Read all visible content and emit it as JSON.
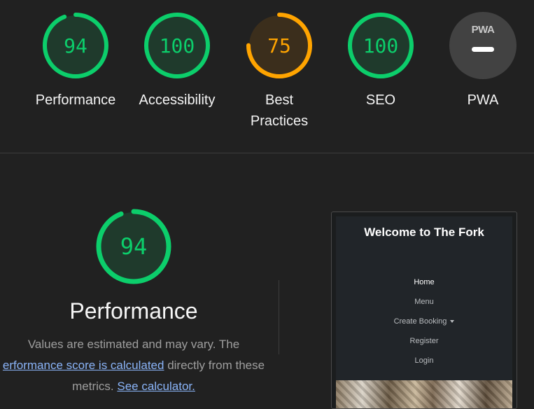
{
  "categories": [
    {
      "score": 94,
      "label_line1": "Performance",
      "label_line2": "",
      "color": "#0cce6b"
    },
    {
      "score": 100,
      "label_line1": "Accessibility",
      "label_line2": "",
      "color": "#0cce6b"
    },
    {
      "score": 75,
      "label_line1": "Best",
      "label_line2": "Practices",
      "color": "#ffa400"
    },
    {
      "score": 100,
      "label_line1": "SEO",
      "label_line2": "",
      "color": "#0cce6b"
    }
  ],
  "pwa": {
    "label": "PWA",
    "badge_text": "PWA"
  },
  "performance": {
    "score": 94,
    "color": "#0cce6b",
    "title": "Performance",
    "desc_line1": "Values are estimated and may vary. The",
    "desc_link1": "erformance score is calculated",
    "desc_after_link1": " directly from these",
    "desc_line3_prefix": "metrics. ",
    "desc_link2": "See calculator."
  },
  "screenshot": {
    "title": "Welcome to The Fork",
    "nav": [
      "Home",
      "Menu",
      "Create Booking",
      "Register",
      "Login"
    ]
  }
}
